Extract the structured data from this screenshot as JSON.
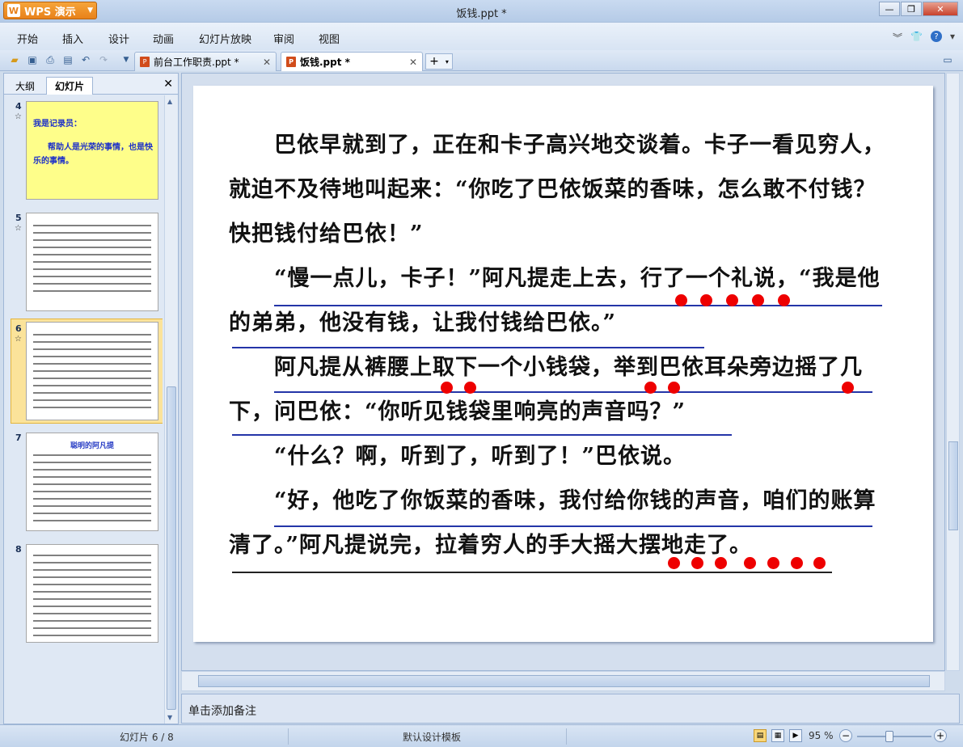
{
  "app": {
    "name": "WPS 演示",
    "title": "饭钱.ppt *"
  },
  "menu": [
    "开始",
    "插入",
    "设计",
    "动画",
    "幻灯片放映",
    "审阅",
    "视图"
  ],
  "doc_tabs": [
    {
      "label": "前台工作职责.ppt *"
    },
    {
      "label": "饭钱.ppt *"
    }
  ],
  "left_panel": {
    "tabs": [
      "大纲",
      "幻灯片"
    ],
    "slide_numbers": [
      "4",
      "5",
      "6",
      "7",
      "8"
    ],
    "star": "☆",
    "slide4": {
      "line1": "我是记录员：",
      "line2": "帮助人是光荣的事情，也是快乐的事情。"
    },
    "slide7": {
      "title": "聪明的阿凡提"
    }
  },
  "slide": {
    "paragraphs": [
      "　　巴依早就到了，正在和卡子高兴地交谈着。卡子一看见穷人，就迫不及待地叫起来：“你吃了巴依饭菜的香味，怎么敢不付钱？快把钱付给巴依！”",
      "　　“慢一点儿，卡子！”阿凡提走上去，行了一个礼说，“我是他的弟弟，他没有钱，让我付钱给巴依。”",
      "　　阿凡提从裤腰上取下一个小钱袋，举到巴依耳朵旁边摇了几下，问巴依：“你听见钱袋里响亮的声音吗？”",
      "　　“什么？啊，听到了，听到了！”巴依说。",
      "　　“好，他吃了你饭菜的香味，我付给你钱的声音，咱们的账算清了。”阿凡提说完，拉着穷人的手大摇大摆地走了。"
    ]
  },
  "notes": {
    "placeholder": "单击添加备注"
  },
  "status": {
    "slide": "幻灯片 6 / 8",
    "template": "默认设计模板",
    "zoom": "95 %"
  }
}
